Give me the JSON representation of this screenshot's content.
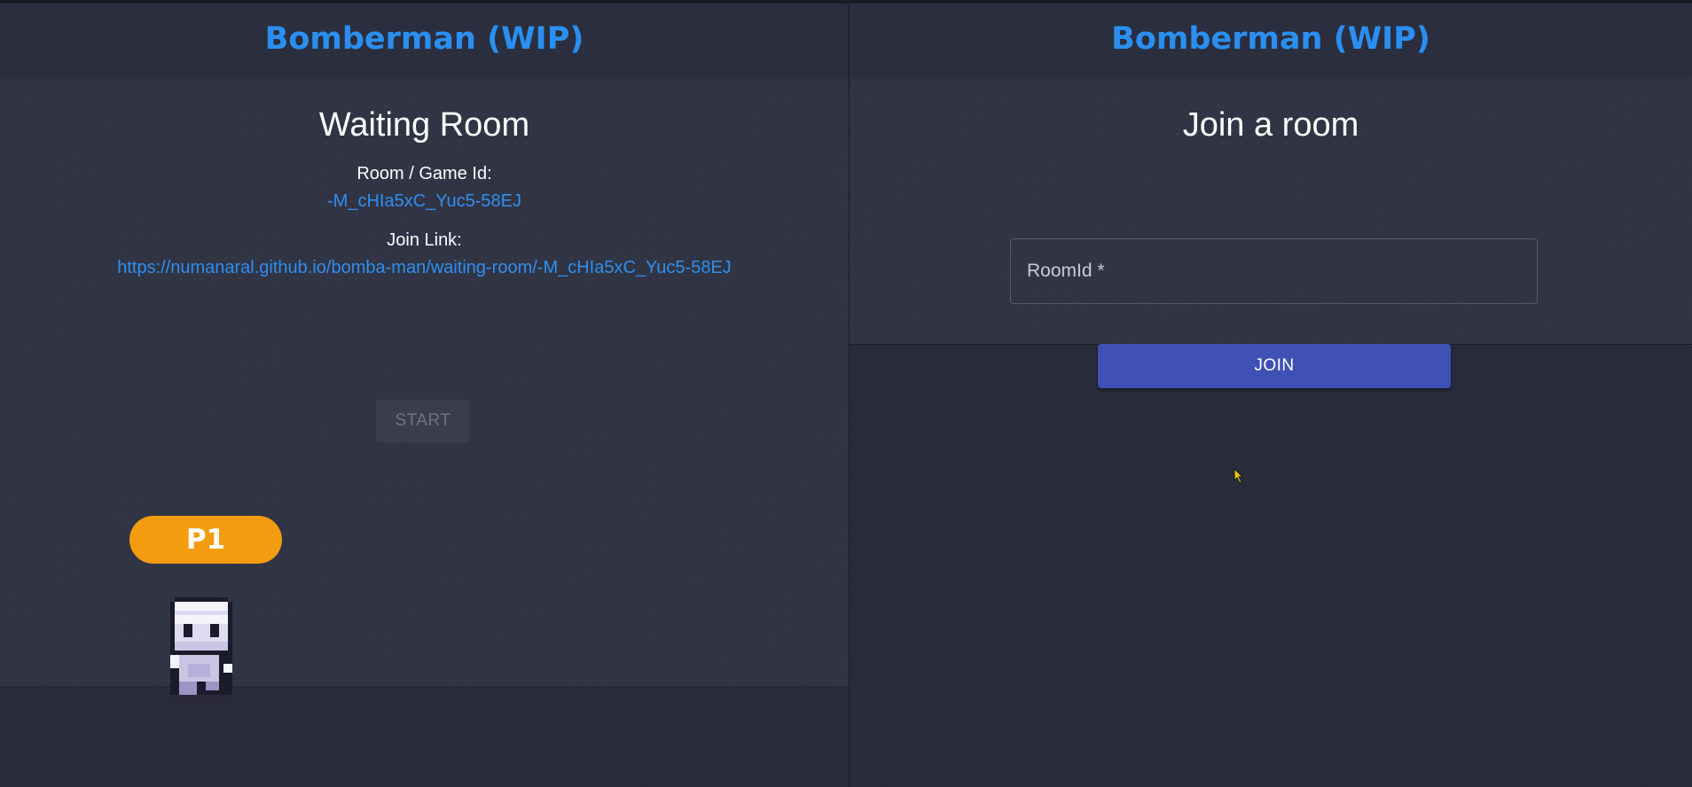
{
  "left_pane": {
    "brand": "Bomberman (WIP)",
    "title": "Waiting Room",
    "room_label": "Room / Game Id:",
    "room_id": "-M_cHIa5xC_Yuc5-58EJ",
    "join_link_label": "Join Link:",
    "join_link": "https://numanaral.github.io/bomba-man/waiting-room/-M_cHIa5xC_Yuc5-58EJ",
    "start_label": "START",
    "player_badge": "P1"
  },
  "right_pane": {
    "brand": "Bomberman (WIP)",
    "title": "Join a room",
    "roomid_placeholder": "RoomId *",
    "roomid_value": "",
    "join_label": "JOIN"
  },
  "colors": {
    "brand": "#2a8ff0",
    "link": "#2f8ff0",
    "badge": "#f39c0f",
    "primary_button": "#3f51b5",
    "background": "#272b3a"
  },
  "icons": {
    "player_sprite": "bomberman-player-sprite-icon",
    "cursor": "mouse-cursor-icon"
  }
}
